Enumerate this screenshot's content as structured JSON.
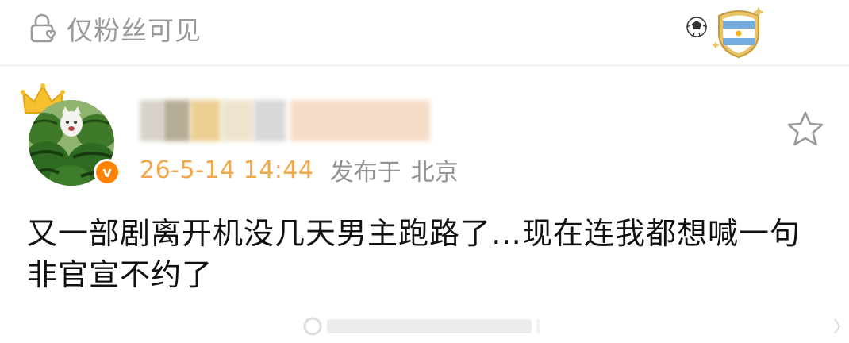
{
  "header": {
    "visibility_label": "仅粉丝可见",
    "visibility_icon": "lock-icon",
    "badge_icons": [
      "football-icon",
      "argentina-flag-badge-icon"
    ]
  },
  "post": {
    "author_avatar_icon": "cat-watermelon-avatar",
    "crown_icon": "crown-icon",
    "verified_badge": "v",
    "time": "26-5-14 14:44",
    "source_prefix": "发布于",
    "location": "北京",
    "favorite_icon": "star-icon",
    "text": "又一部剧离开机没几天男主跑路了…现在连我都想喊一句非官宣不约了"
  },
  "colors": {
    "time": "#f0a84a",
    "muted": "#939393",
    "verified": "#ff8200",
    "crown": "#f6c130"
  }
}
